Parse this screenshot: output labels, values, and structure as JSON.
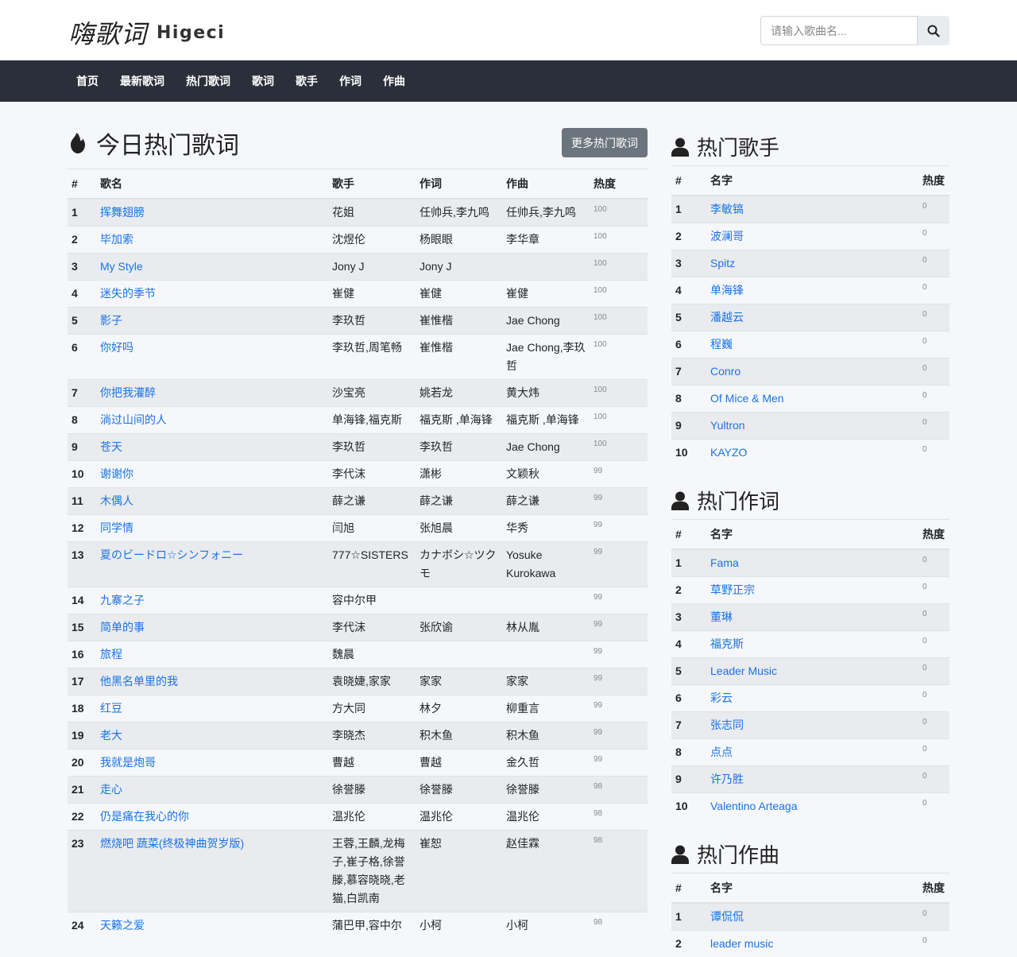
{
  "header": {
    "logo_cn": "嗨歌词",
    "logo_en": "Higeci",
    "search_placeholder": "请输入歌曲名..."
  },
  "nav": [
    "首页",
    "最新歌词",
    "热门歌词",
    "歌词",
    "歌手",
    "作词",
    "作曲"
  ],
  "main": {
    "title": "今日热门歌词",
    "more_button": "更多热门歌词",
    "columns": [
      "#",
      "歌名",
      "歌手",
      "作词",
      "作曲",
      "热度"
    ],
    "rows": [
      [
        "1",
        "挥舞翅膀",
        "花姐",
        "任帅兵,李九鸣",
        "任帅兵,李九鸣",
        "100"
      ],
      [
        "2",
        "毕加索",
        "沈煜伦",
        "杨眼眼",
        "李华章",
        "100"
      ],
      [
        "3",
        "My Style",
        "Jony J",
        "Jony J",
        "",
        "100"
      ],
      [
        "4",
        "迷失的季节",
        "崔健",
        "崔健",
        "崔健",
        "100"
      ],
      [
        "5",
        "影子",
        "李玖哲",
        "崔惟楷",
        "Jae Chong",
        "100"
      ],
      [
        "6",
        "你好吗",
        "李玖哲,周笔畅",
        "崔惟楷",
        "Jae Chong,李玖哲",
        "100"
      ],
      [
        "7",
        "你把我灌醉",
        "沙宝亮",
        "姚若龙",
        "黄大炜",
        "100"
      ],
      [
        "8",
        "淌过山间的人",
        "单海锋,福克斯",
        "福克斯 ,单海锋",
        "福克斯 ,单海锋",
        "100"
      ],
      [
        "9",
        "苍天",
        "李玖哲",
        "李玖哲",
        "Jae Chong",
        "100"
      ],
      [
        "10",
        "谢谢你",
        "李代沫",
        "潇彬",
        "文颖秋",
        "99"
      ],
      [
        "11",
        "木偶人",
        "薛之谦",
        "薛之谦",
        "薛之谦",
        "99"
      ],
      [
        "12",
        "同学情",
        "闫旭",
        "张旭晨",
        "华秀",
        "99"
      ],
      [
        "13",
        "夏のビードロ☆シンフォニー",
        "777☆SISTERS",
        "カナボシ☆ツクモ",
        "Yosuke Kurokawa",
        "99"
      ],
      [
        "14",
        "九寨之子",
        "容中尔甲",
        "",
        "",
        "99"
      ],
      [
        "15",
        "简单的事",
        "李代沫",
        "张欣谕",
        "林从胤",
        "99"
      ],
      [
        "16",
        "旅程",
        "魏晨",
        "",
        "",
        "99"
      ],
      [
        "17",
        "他黑名单里的我",
        "袁晓婕,家家",
        "家家",
        "家家",
        "99"
      ],
      [
        "18",
        "红豆",
        "方大同",
        "林夕",
        "柳重言",
        "99"
      ],
      [
        "19",
        "老大",
        "李晓杰",
        "积木鱼",
        "积木鱼",
        "99"
      ],
      [
        "20",
        "我就是炮哥",
        "曹越",
        "曹越",
        "金久哲",
        "99"
      ],
      [
        "21",
        "走心",
        "徐誉滕",
        "徐誉滕",
        "徐誉滕",
        "98"
      ],
      [
        "22",
        "仍是痛在我心的你",
        "温兆伦",
        "温兆伦",
        "温兆伦",
        "98"
      ],
      [
        "23",
        "燃烧吧 蔬菜(终极神曲贺岁版)",
        "王蓉,王麟,龙梅子,崔子格,徐誉滕,慕容晓晓,老猫,白凯南",
        "崔恕",
        "赵佳霖",
        "98"
      ],
      [
        "24",
        "天籁之爱",
        "蒲巴甲,容中尔",
        "小柯",
        "小柯",
        "98"
      ]
    ]
  },
  "side": [
    {
      "title": "热门歌手",
      "columns": [
        "#",
        "名字",
        "热度"
      ],
      "rows": [
        [
          "1",
          "李敏镐",
          "0"
        ],
        [
          "2",
          "波澜哥",
          "0"
        ],
        [
          "3",
          "Spitz",
          "0"
        ],
        [
          "4",
          "单海锋",
          "0"
        ],
        [
          "5",
          "潘越云",
          "0"
        ],
        [
          "6",
          "程巍",
          "0"
        ],
        [
          "7",
          "Conro",
          "0"
        ],
        [
          "8",
          "Of Mice & Men",
          "0"
        ],
        [
          "9",
          "Yultron",
          "0"
        ],
        [
          "10",
          "KAYZO",
          "0"
        ]
      ]
    },
    {
      "title": "热门作词",
      "columns": [
        "#",
        "名字",
        "热度"
      ],
      "rows": [
        [
          "1",
          "Fama",
          "0"
        ],
        [
          "2",
          "草野正宗",
          "0"
        ],
        [
          "3",
          "董琳",
          "0"
        ],
        [
          "4",
          "福克斯",
          "0"
        ],
        [
          "5",
          "Leader Music",
          "0"
        ],
        [
          "6",
          "彩云",
          "0"
        ],
        [
          "7",
          "张志同",
          "0"
        ],
        [
          "8",
          "点点",
          "0"
        ],
        [
          "9",
          "许乃胜",
          "0"
        ],
        [
          "10",
          "Valentino Arteaga",
          "0"
        ]
      ]
    },
    {
      "title": "热门作曲",
      "columns": [
        "#",
        "名字",
        "热度"
      ],
      "rows": [
        [
          "1",
          "谭侃侃",
          "0"
        ],
        [
          "2",
          "leader music",
          "0"
        ]
      ]
    }
  ]
}
